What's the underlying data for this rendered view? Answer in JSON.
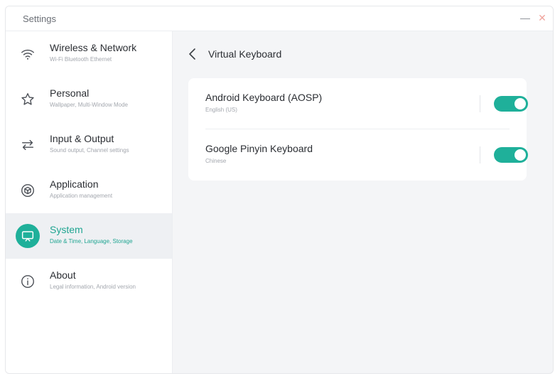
{
  "window": {
    "title": "Settings",
    "minimize_glyph": "—",
    "close_glyph": "✕"
  },
  "sidebar": {
    "items": [
      {
        "label": "Wireless & Network",
        "sub": "Wi-Fi Bluetooth Ethernet",
        "icon": "wifi-icon"
      },
      {
        "label": "Personal",
        "sub": "Wallpaper, Multi-Window Mode",
        "icon": "star-icon"
      },
      {
        "label": "Input & Output",
        "sub": "Sound output, Channel settings",
        "icon": "swap-arrows-icon"
      },
      {
        "label": "Application",
        "sub": "Application management",
        "icon": "cube-icon"
      },
      {
        "label": "System",
        "sub": "Date & Time, Language, Storage",
        "icon": "monitor-icon",
        "active": true
      },
      {
        "label": "About",
        "sub": "Legal information, Android version",
        "icon": "info-icon"
      }
    ]
  },
  "main": {
    "title": "Virtual Keyboard",
    "keyboards": [
      {
        "name": "Android Keyboard (AOSP)",
        "language": "English (US)",
        "enabled": true
      },
      {
        "name": "Google Pinyin Keyboard",
        "language": "Chinese",
        "enabled": true
      }
    ]
  },
  "colors": {
    "accent": "#1fb09a",
    "accent_text": "#1fa591",
    "window_bg": "#f4f5f7",
    "panel_bg": "#ffffff",
    "close": "#f0a59e"
  }
}
